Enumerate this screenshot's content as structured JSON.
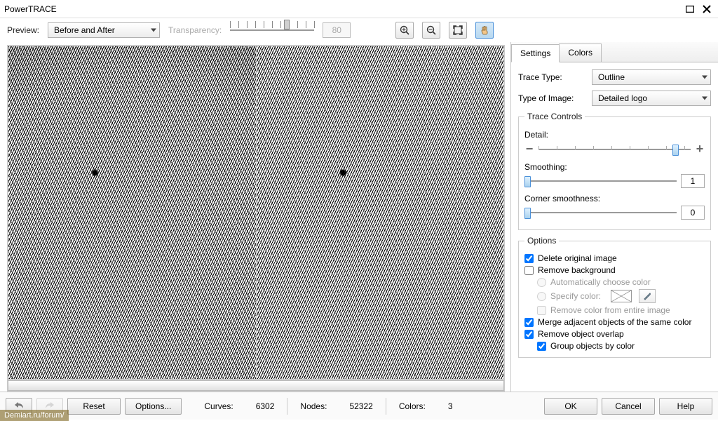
{
  "window": {
    "title": "PowerTRACE"
  },
  "toolbar": {
    "preview_label": "Preview:",
    "preview_value": "Before and After",
    "transparency_label": "Transparency:",
    "transparency_value": "80"
  },
  "tabs": {
    "settings": "Settings",
    "colors": "Colors"
  },
  "settings": {
    "trace_type_label": "Trace Type:",
    "trace_type_value": "Outline",
    "image_type_label": "Type of Image:",
    "image_type_value": "Detailed logo",
    "trace_controls_legend": "Trace Controls",
    "detail_label": "Detail:",
    "smoothing_label": "Smoothing:",
    "smoothing_value": "1",
    "corner_label": "Corner smoothness:",
    "corner_value": "0",
    "options_legend": "Options",
    "delete_original": "Delete original image",
    "remove_background": "Remove background",
    "auto_color": "Automatically choose color",
    "specify_color": "Specify color:",
    "remove_color_entire": "Remove color from entire image",
    "merge_adjacent": "Merge adjacent objects of the same color",
    "remove_overlap": "Remove object overlap",
    "group_by_color": "Group objects by color"
  },
  "footer": {
    "reset": "Reset",
    "options": "Options...",
    "curves_label": "Curves:",
    "curves_value": "6302",
    "nodes_label": "Nodes:",
    "nodes_value": "52322",
    "colors_label": "Colors:",
    "colors_value": "3",
    "ok": "OK",
    "cancel": "Cancel",
    "help": "Help"
  },
  "watermark": "Demiart.ru/forum/"
}
